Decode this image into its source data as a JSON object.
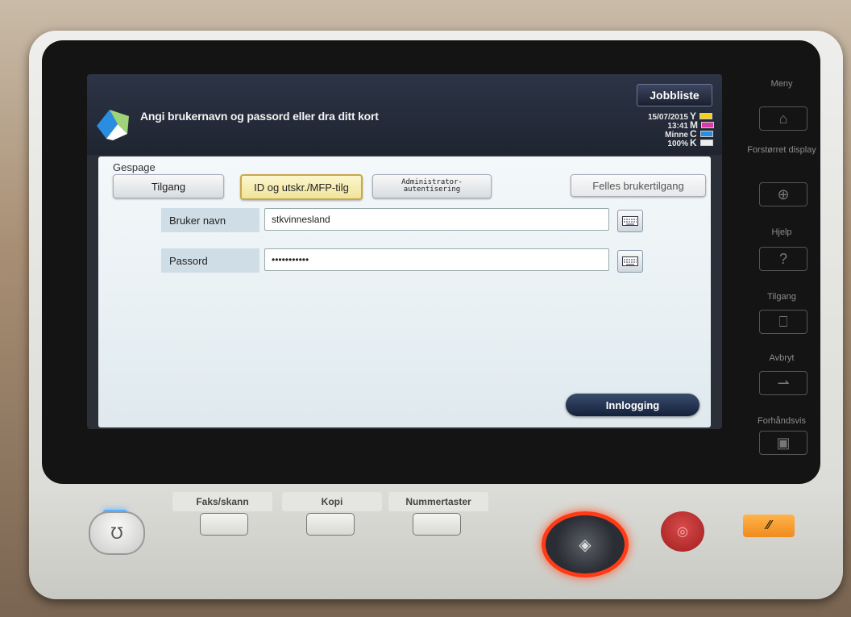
{
  "header": {
    "job_list": "Jobbliste",
    "instruction": "Angi brukernavn og passord eller dra ditt kort",
    "date": "15/07/2015",
    "time": "13:41",
    "memory_label": "Minne",
    "memory_value": "100%",
    "toner": [
      {
        "letter": "Y",
        "color": "#f2d21e"
      },
      {
        "letter": "M",
        "color": "#d83aa8"
      },
      {
        "letter": "C",
        "color": "#2a8fe0"
      },
      {
        "letter": "K",
        "color": "#222222"
      }
    ]
  },
  "panel": {
    "title": "Gespage",
    "tabs": {
      "access": "Tilgang",
      "id_print": "ID og utskr./MFP-tilg",
      "admin_auth": "Administrator-\nautentisering",
      "public_access": "Felles brukertilgang"
    },
    "username_label": "Bruker navn",
    "username_value": "stkvinnesland",
    "password_label": "Passord",
    "password_value": "•••••••••••",
    "login_button": "Innlogging"
  },
  "side_menu": {
    "menu": "Meny",
    "enlarged_display": "Forstørret display",
    "help": "Hjelp",
    "access": "Tilgang",
    "interrupt": "Avbryt",
    "preview": "Forhåndsvis"
  },
  "hardware_keys": {
    "fax_scan": "Faks/skann",
    "copy": "Kopi",
    "numeric_keys": "Nummertaster"
  }
}
